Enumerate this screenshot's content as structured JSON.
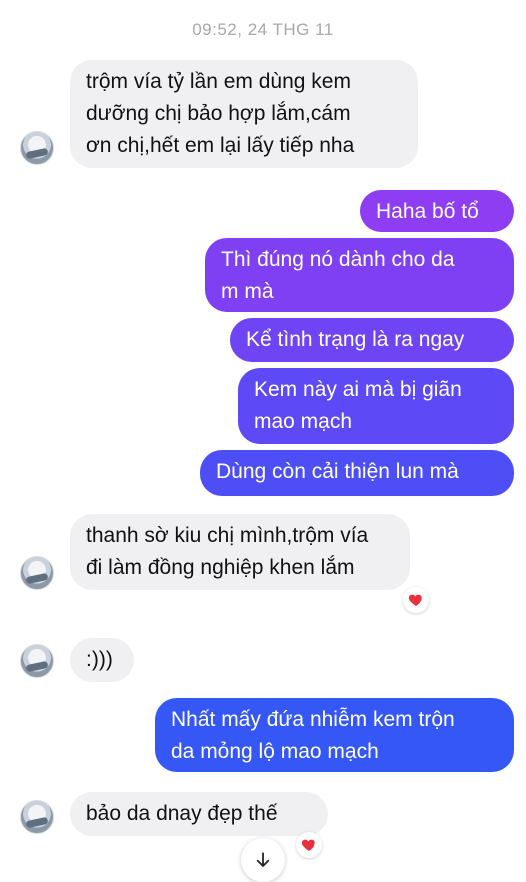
{
  "conversation": {
    "timestamp": "09:52, 24 THG 11",
    "messages": [
      {
        "sender": "them",
        "text": "trộm vía tỷ lần em dùng kem\ndưỡng chị bảo hợp lắm,cám\nơn chị,hết em lại lấy tiếp nha"
      },
      {
        "sender": "me",
        "text": "Haha bố tổ"
      },
      {
        "sender": "me",
        "text": "Thì đúng nó dành cho da\nm mà"
      },
      {
        "sender": "me",
        "text": "Kể tình trạng là ra ngay"
      },
      {
        "sender": "me",
        "text": "Kem này ai mà bị giãn\nmao mạch"
      },
      {
        "sender": "me",
        "text": "Dùng còn cải thiện lun mà"
      },
      {
        "sender": "them",
        "text": "thanh sờ kiu chị mình,trộm vía\nđi làm đồng nghiệp khen lắm",
        "reaction": "heart"
      },
      {
        "sender": "them",
        "text": ":)))"
      },
      {
        "sender": "me",
        "text": "Nhất mấy đứa nhiễm kem trộn\nda mỏng lộ mao mạch"
      },
      {
        "sender": "them",
        "text": "bảo da dnay đẹp thế",
        "reaction": "heart"
      }
    ]
  },
  "colors": {
    "incoming_bubble": "#f0f0f2",
    "outgoing_gradient_top": "#8f3df3",
    "outgoing_gradient_bottom": "#2f57f5",
    "heart": "#e8303f",
    "timestamp": "#a8a8ad"
  },
  "icons": {
    "reaction": "heart-icon",
    "scroll": "arrow-down-icon"
  }
}
